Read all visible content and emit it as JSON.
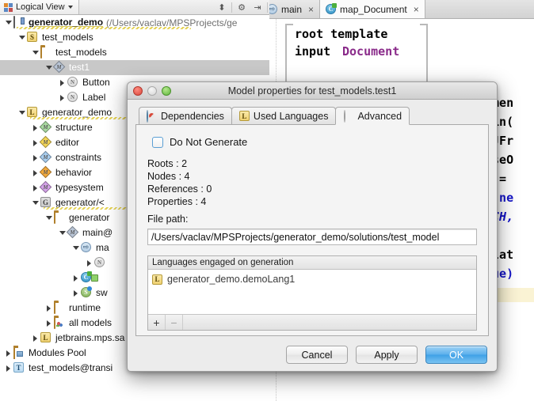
{
  "left_panel": {
    "toolbar": {
      "view_tab_label": "Logical View",
      "view_tab_icon": "project-squares-icon",
      "dropdown_icon": "chevron-down-icon",
      "buttons": [
        {
          "name": "expand-collapse-icon",
          "glyph": "⬍"
        },
        {
          "name": "settings-gear-icon",
          "glyph": "⚙"
        },
        {
          "name": "hide-panel-icon",
          "glyph": "⇥"
        }
      ]
    },
    "tree": [
      {
        "indent": 0,
        "twisty": "open",
        "icon": "project-icon",
        "label": "generator_demo",
        "bold": true,
        "sub": "(/Users/vaclav/MPSProjects/ge",
        "squiggle": true
      },
      {
        "indent": 1,
        "twisty": "open",
        "icon": "solution-s-icon",
        "label": "test_models"
      },
      {
        "indent": 2,
        "twisty": "open",
        "icon": "folder-icon",
        "label": "test_models"
      },
      {
        "indent": 3,
        "twisty": "open",
        "icon": "model-diamond-icon",
        "label": "test1",
        "selected": true
      },
      {
        "indent": 4,
        "twisty": "closed",
        "icon": "node-n-icon",
        "label": "Button"
      },
      {
        "indent": 4,
        "twisty": "closed",
        "icon": "node-n-icon",
        "label": "Label"
      },
      {
        "indent": 1,
        "twisty": "open",
        "icon": "language-l-icon",
        "label": "generator_demo",
        "squiggle": true
      },
      {
        "indent": 2,
        "twisty": "closed",
        "icon": "structure-model-icon",
        "label": "structure"
      },
      {
        "indent": 2,
        "twisty": "closed",
        "icon": "editor-model-icon",
        "label": "editor"
      },
      {
        "indent": 2,
        "twisty": "closed",
        "icon": "constraints-model-icon",
        "label": "constraints"
      },
      {
        "indent": 2,
        "twisty": "closed",
        "icon": "behavior-model-icon",
        "label": "behavior"
      },
      {
        "indent": 2,
        "twisty": "closed",
        "icon": "typesystem-model-icon",
        "label": "typesystem"
      },
      {
        "indent": 2,
        "twisty": "open",
        "icon": "generator-g-icon",
        "label": "generator/<",
        "squiggle": true
      },
      {
        "indent": 3,
        "twisty": "open",
        "icon": "folder-icon",
        "label": "generator"
      },
      {
        "indent": 4,
        "twisty": "open",
        "icon": "model-diamond-icon",
        "label": "main@"
      },
      {
        "indent": 5,
        "twisty": "open",
        "icon": "mapping-arrow-icon",
        "label": "ma"
      },
      {
        "indent": 6,
        "twisty": "closed",
        "icon": "node-n-icon",
        "label": ""
      },
      {
        "indent": 5,
        "twisty": "closed",
        "icon": "class-c-icon",
        "label": ""
      },
      {
        "indent": 5,
        "twisty": "closed",
        "icon": "switch-s-icon",
        "label": "sw"
      },
      {
        "indent": 3,
        "twisty": "closed",
        "icon": "folder-icon",
        "label": "runtime"
      },
      {
        "indent": 3,
        "twisty": "closed",
        "icon": "all-models-icon",
        "label": "all models"
      },
      {
        "indent": 2,
        "twisty": "closed",
        "icon": "language-l-icon",
        "label": "jetbrains.mps.sa"
      },
      {
        "indent": 0,
        "twisty": "closed",
        "icon": "modules-pool-icon",
        "label": "Modules Pool"
      },
      {
        "indent": 0,
        "twisty": "closed",
        "icon": "transient-t-icon",
        "label": "test_models@transi"
      }
    ]
  },
  "editor": {
    "tabs": [
      {
        "label": "main",
        "icon": "mapping-arrow-icon",
        "active": false,
        "close_glyph": "×"
      },
      {
        "label": "map_Document",
        "icon": "class-c-icon",
        "active": true,
        "close_glyph": "×"
      }
    ],
    "code_lines": [
      {
        "text": "root template",
        "style": "kw"
      },
      {
        "text": "input ",
        "style": "kw",
        "text2": "Document",
        "style2": "ty"
      }
    ],
    "right_fragments": [
      "umen",
      "ain(",
      " JFr",
      "oseO",
      "r = ",
      "t(ne",
      "TCH,",
      "elat",
      "rue)"
    ]
  },
  "dialog": {
    "title": "Model properties for test_models.test1",
    "window_controls": [
      "close-button",
      "minimize-button",
      "zoom-button"
    ],
    "tabs": [
      {
        "label": "Dependencies",
        "icon": "globe-icon",
        "active": false
      },
      {
        "label": "Used Languages",
        "icon": "language-l-icon",
        "active": false
      },
      {
        "label": "Advanced",
        "icon": "radio-dot-icon",
        "active": true
      }
    ],
    "checkbox": {
      "label": "Do Not Generate",
      "checked": false
    },
    "stats": [
      "Roots : 2",
      "Nodes : 4",
      "References : 0",
      "Properties : 4"
    ],
    "file_path_label": "File path:",
    "file_path_value": "/Users/vaclav/MPSProjects/generator_demo/solutions/test_model",
    "languages_panel": {
      "header": "Languages engaged on generation",
      "items": [
        {
          "icon": "language-l-icon",
          "label": "generator_demo.demoLang1"
        }
      ],
      "toolbar": {
        "add_glyph": "+",
        "remove_glyph": "−"
      }
    },
    "buttons": {
      "cancel": "Cancel",
      "apply": "Apply",
      "ok": "OK"
    }
  },
  "colors": {
    "dialog_bg": "#ececec",
    "panel_bg": "#f4f4f4",
    "default_button": "#5cb0ec",
    "selection": "#c8c8c8",
    "type_purple": "#8a2b8a",
    "keyword_blue": "#1414c8",
    "squiggle_yellow": "#e3cf4a"
  }
}
